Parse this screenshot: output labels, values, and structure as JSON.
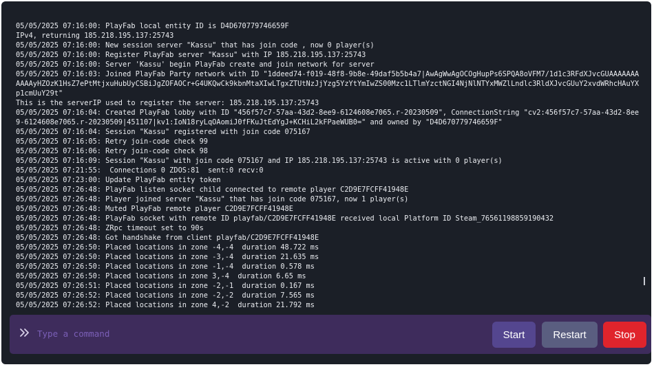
{
  "console": {
    "lines": [
      "05/05/2025 07:16:00: PlayFab local entity ID is D4D670779746659F",
      "IPv4, returning 185.218.195.137:25743",
      "05/05/2025 07:16:00: New session server \"Kassu\" that has join code , now 0 player(s)",
      "05/05/2025 07:16:00: Register PlayFab server \"Kassu\" with IP 185.218.195.137:25743",
      "05/05/2025 07:16:00: Server 'Kassu' begin PlayFab create and join network for server",
      "05/05/2025 07:16:03: Joined PlayFab Party network with ID \"1ddeed74-f019-48f8-9b8e-49daf5b5b4a7|AwAgWwAgOCOgHupPs6SPQA8oVFM7/1d1c3RFdXJvcGUAAAAAAAAAAAyHZOzK1HsZ7ePtMtjxuHubUyCSBiJgZOFAOCr+G4UKQwCk9kbnMtaXIwLTgxZTUtNzJjYzg5YzYtYmIwZS00Mzc1LTlmYzctNGI4NjNlNTYxMWZlLndlc3RldXJvcGUuY2xvdWRhcHAuYXp1cmUuY29t\"",
      "This is the serverIP used to register the server: 185.218.195.137:25743",
      "05/05/2025 07:16:04: Created PlayFab lobby with ID \"456f57c7-57aa-43d2-8ee9-6124608e7065.r-20230509\", ConnectionString \"cv2:456f57c7-57aa-43d2-8ee9-6124608e7065.r-20230509|451107|kv1:IoN18ryLqOAomiJ0fFKuJtEdYgJ+KCHiL2kFPaeWUB0=\" and owned by \"D4D670779746659F\"",
      "05/05/2025 07:16:04: Session \"Kassu\" registered with join code 075167",
      "05/05/2025 07:16:05: Retry join-code check 99",
      "05/05/2025 07:16:06: Retry join-code check 98",
      "05/05/2025 07:16:09: Session \"Kassu\" with join code 075167 and IP 185.218.195.137:25743 is active with 0 player(s)",
      "05/05/2025 07:21:55:  Connections 0 ZDOS:81  sent:0 recv:0",
      "05/05/2025 07:23:00: Update PlayFab entity token",
      "05/05/2025 07:26:48: PlayFab listen socket child connected to remote player C2D9E7FCFF41948E",
      "05/05/2025 07:26:48: Player joined server \"Kassu\" that has join code 075167, now 1 player(s)",
      "05/05/2025 07:26:48: Muted PlayFab remote player C2D9E7FCFF41948E",
      "05/05/2025 07:26:48: PlayFab socket with remote ID playfab/C2D9E7FCFF41948E received local Platform ID Steam_76561198859190432",
      "05/05/2025 07:26:48: ZRpc timeout set to 90s",
      "05/05/2025 07:26:48: Got handshake from client playfab/C2D9E7FCFF41948E",
      "05/05/2025 07:26:50: Placed locations in zone -4,-4  duration 48.722 ms",
      "05/05/2025 07:26:50: Placed locations in zone -3,-4  duration 21.635 ms",
      "05/05/2025 07:26:50: Placed locations in zone -1,-4  duration 0.578 ms",
      "05/05/2025 07:26:50: Placed locations in zone 3,-4  duration 6.65 ms",
      "05/05/2025 07:26:51: Placed locations in zone -2,-1  duration 0.167 ms",
      "05/05/2025 07:26:52: Placed locations in zone -2,-2  duration 7.565 ms",
      "05/05/2025 07:26:52: Placed locations in zone 4,-2  duration 21.792 ms"
    ]
  },
  "command": {
    "prompt_icon": "double-chevron-right-icon",
    "placeholder": "Type a command",
    "value": ""
  },
  "buttons": {
    "start": "Start",
    "restart": "Restart",
    "stop": "Stop"
  },
  "colors": {
    "background": "#1b1f27",
    "command_bar": "#3e2c5c",
    "start": "#54468f",
    "restart": "#5a5e80",
    "stop": "#e0242c"
  }
}
